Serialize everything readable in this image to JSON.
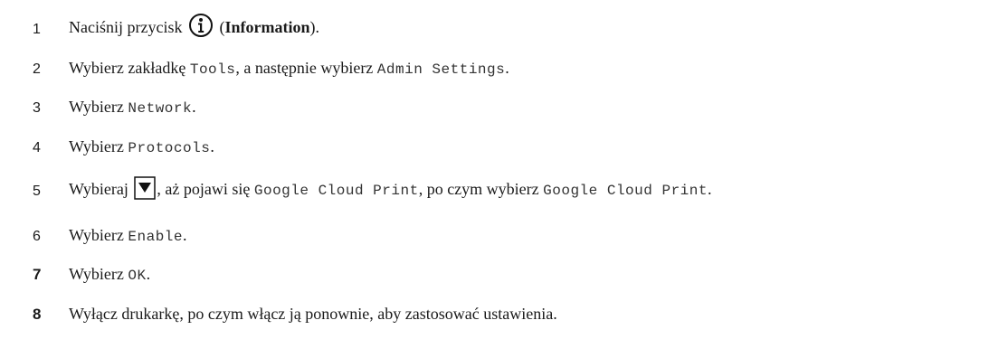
{
  "steps": [
    {
      "number": "1",
      "t1": "Naciśnij przycisk ",
      "t2": " (",
      "button_name": "Information",
      "t3": ")."
    },
    {
      "number": "2",
      "t1": "Wybierz zakładkę ",
      "m1": "Tools",
      "t2": ", a następnie wybierz ",
      "m2": "Admin Settings",
      "t3": "."
    },
    {
      "number": "3",
      "t1": "Wybierz ",
      "m1": "Network",
      "t2": "."
    },
    {
      "number": "4",
      "t1": "Wybierz ",
      "m1": "Protocols",
      "t2": "."
    },
    {
      "number": "5",
      "t1": "Wybieraj ",
      "t2": ", aż pojawi się ",
      "m1": "Google Cloud Print",
      "t3": ", po czym wybierz ",
      "m2": "Google Cloud Print",
      "t4": "."
    },
    {
      "number": "6",
      "t1": "Wybierz ",
      "m1": "Enable",
      "t2": "."
    },
    {
      "number": "7",
      "t1": "Wybierz ",
      "m1": "OK",
      "t2": "."
    },
    {
      "number": "8",
      "t1": "Wyłącz drukarkę, po czym włącz ją ponownie, aby zastosować ustawienia."
    }
  ],
  "icons": {
    "info": "information-circle-icon",
    "down": "down-arrow-button-icon"
  }
}
